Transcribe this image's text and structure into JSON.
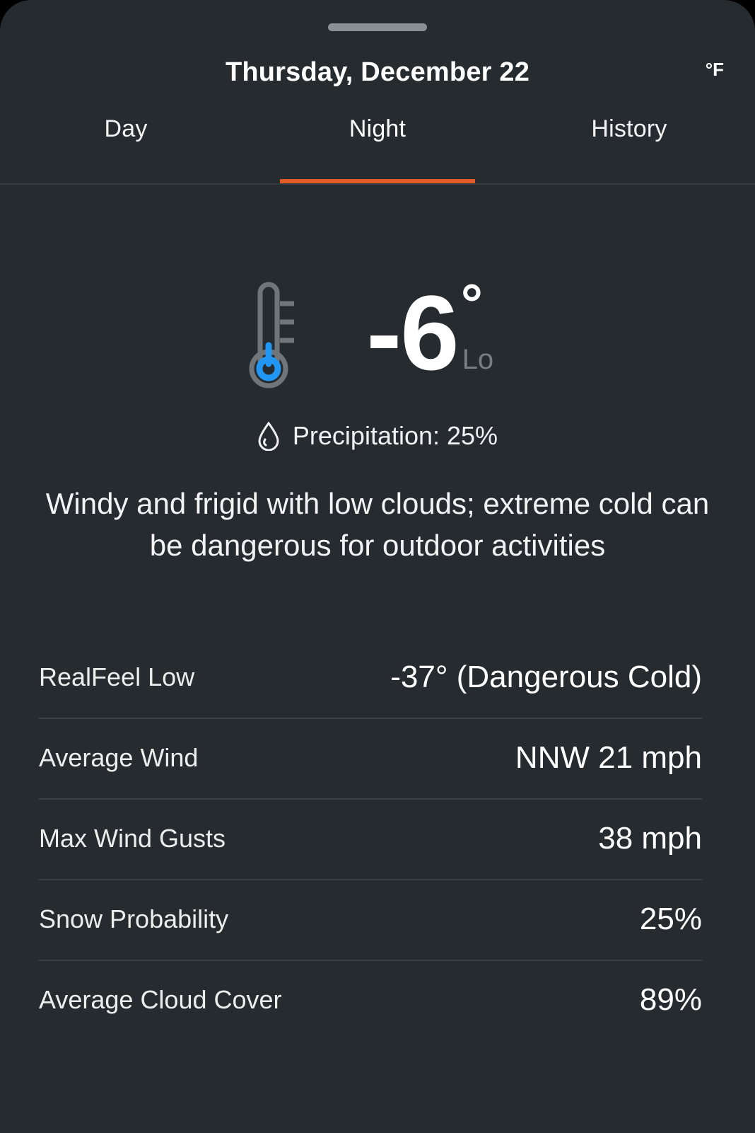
{
  "window": {
    "drag_handle": "drag-handle"
  },
  "header": {
    "title": "Thursday, December 22",
    "unit": "°F"
  },
  "tabs": [
    {
      "label": "Day",
      "active": false
    },
    {
      "label": "Night",
      "active": true
    },
    {
      "label": "History",
      "active": false
    }
  ],
  "accent_color": "#e35b26",
  "background_color": "#262b2f",
  "current": {
    "thermometer_icon": "thermometer-icon",
    "temperature": "-6",
    "degree": "°",
    "lohi": "Lo",
    "precipitation_icon": "water-drop-icon",
    "precipitation": "Precipitation: 25%",
    "phrase": "Windy and frigid with low clouds; extreme cold can be dangerous for outdoor activities"
  },
  "details": [
    {
      "label": "RealFeel Low",
      "value": "-37° (Dangerous Cold)"
    },
    {
      "label": "Average Wind",
      "value": "NNW 21 mph"
    },
    {
      "label": "Max Wind Gusts",
      "value": "38 mph"
    },
    {
      "label": "Snow Probability",
      "value": "25%"
    },
    {
      "label": "Average Cloud Cover",
      "value": "89%"
    }
  ]
}
